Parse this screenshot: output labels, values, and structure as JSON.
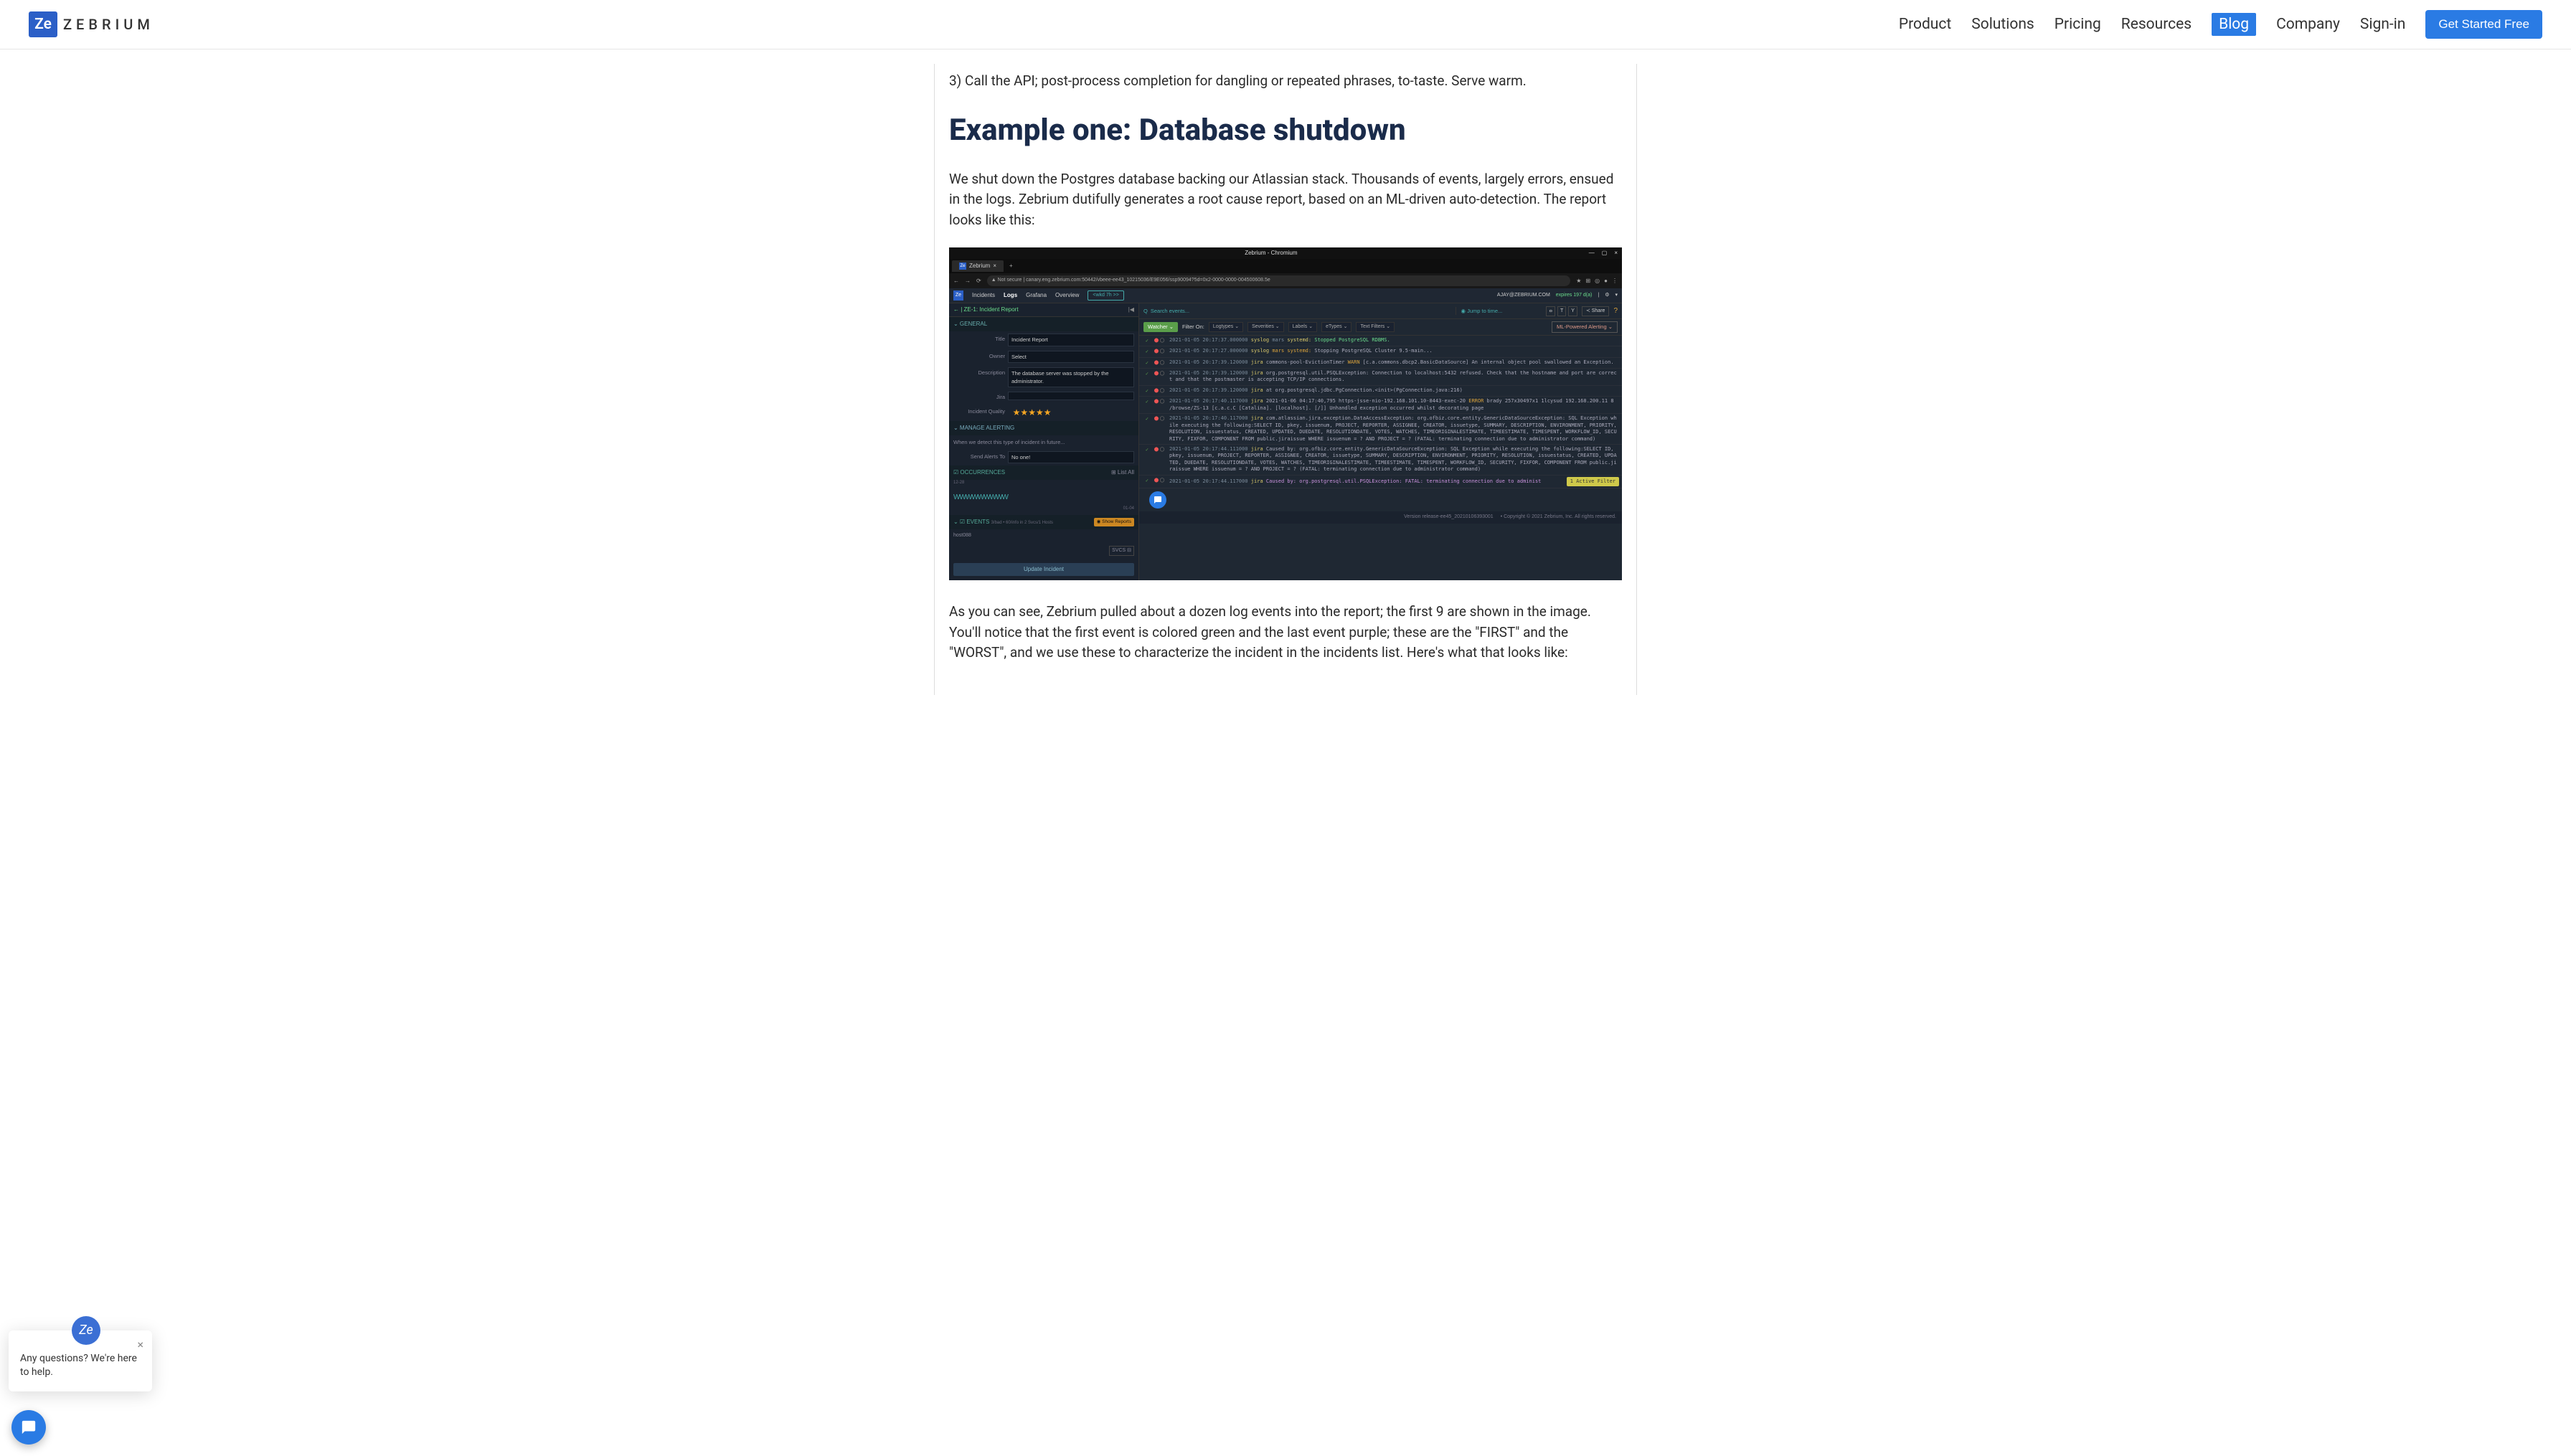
{
  "brand": {
    "badge": "Ze",
    "name": "ZEBRIUM"
  },
  "nav": {
    "product": "Product",
    "solutions": "Solutions",
    "pricing": "Pricing",
    "resources": "Resources",
    "blog": "Blog",
    "company": "Company",
    "signin": "Sign-in",
    "cta": "Get Started Free"
  },
  "article": {
    "step3": "3) Call the API; post-process completion for dangling or repeated phrases, to-taste. Serve warm.",
    "h2": "Example one: Database shutdown",
    "intro": "We shut down the Postgres database backing our Atlassian stack. Thousands of events, largely errors, ensued in the logs. Zebrium dutifully generates a root cause report, based on an ML-driven auto-detection. The report looks like this:",
    "after": "As you can see, Zebrium pulled about a dozen log events into the report; the first 9 are shown in the image. You'll notice that the first event is colored green and the last event purple; these are the \"FIRST\" and the \"WORST\", and we use these to characterize the incident in the incidents list. Here's what that looks like:"
  },
  "embed": {
    "chrome": {
      "title": "Zebrium - Chromium",
      "min": "—",
      "max": "▢",
      "close": "×"
    },
    "tab": {
      "favicon": "Ze",
      "label": "Zebrium",
      "close": "×"
    },
    "url": {
      "back": "←",
      "fwd": "→",
      "reload": "⟳",
      "lock": "▲ Not secure",
      "text": "canary.eng.zebrium.com:50442/vbeee-ee43_10215036/E9E056/ssp90094?5d=0x2-0000-0000-004500608.5e",
      "star": "★"
    },
    "app": {
      "logo": "Ze",
      "tab_incidents": "Incidents",
      "tab_logs": "Logs",
      "tab_grafana": "Grafana",
      "tab_overview": "Overview",
      "timerange": "<wkd 7h >>",
      "user": "AJAY@ZEBRIUM.COM",
      "expiry": "expires 197 d(a)"
    },
    "sidebar": {
      "header": "← | ZE-1: Incident Report",
      "collapse": "|◀",
      "general": "⌄ GENERAL",
      "title_label": "Title",
      "title_val": "Incident Report",
      "owner_label": "Owner",
      "owner_val": "Select",
      "desc_label": "Description",
      "desc_val": "The database server was stopped by the administrator.",
      "jira_label": "Jira",
      "quality_label": "Incident Quality",
      "stars": "★★★★★",
      "manage": "⌄ MANAGE ALERTING",
      "future": "When we detect this type of incident in future...",
      "sendto_label": "Send Alerts To",
      "sendto_val": "No one!",
      "occ": "☑ OCCURRENCES",
      "occ_right": "⊞ List All",
      "spark_start": "12-28",
      "spark_end": "01-04",
      "spark": "WWWWWWWWW",
      "events": "⌄ ☑ EVENTS",
      "events_sub": "3/bad • 60/info in 2 Svcs/1 Hosts",
      "show_reports": "◉ Show Reports",
      "host": "host088",
      "svcs_label": "SVCS ⊟",
      "update": "Update Incident"
    },
    "searchbar": {
      "icon": "Q",
      "placeholder": "Search events...",
      "jump": "◉ Jump to time...",
      "a": "ⴰ",
      "t": "T",
      "y": "Y",
      "share": "≺ Share",
      "help": "?"
    },
    "filters": {
      "watcher": "Watcher ⌄",
      "filteron": "Filter On:",
      "logtypes": "Logtypes ⌄",
      "severities": "Severities ⌄",
      "labels": "Labels ⌄",
      "etypes": "eTypes ⌄",
      "textfilters": "Text Filters ⌄",
      "ml": "ML-Powered Alerting ⌄"
    },
    "logs": [
      "2021-01-05 20:17:37.000000 syslog mars systemd: Stopped PostgreSQL RDBMS.",
      "2021-01-05 20:17:37.000000 syslog mars systemd: Stopping PostgreSQL Cluster 9.5-main...",
      "2021-01-05 20:17:39.120000 jira commons-pool-EvictionTimer WARN [c.a.commons.dbcp2.BasicDataSource] An internal object pool swallowed an Exception.",
      "2021-01-05 20:17:39.120000 jira org.postgresql.util.PSQLException: Connection to localhost:5432 refused. Check that the hostname and port are correct and that the postmaster is accepting TCP/IP connections.",
      "2021-01-05 20:17:39.120000 jira at org.postgresql.jdbc.PgConnection.<init>(PgConnection.java:216)",
      "2021-01-05 20:17:40.117000 jira 2021-01-06 04:17:40,795 https-jsse-nio-192.168.101.10-8443-exec-20 ERROR brady 257x30497x1 1lcysud 192.168.200.11 8 /browse/ZS-13 [c.a.c.C [Catalina]. [localhost]. [/]] Unhandled exception occurred whilst decorating page",
      "2021-01-05 20:17:40.117000 jira com.atlassian.jira.exception.DataAccessException: org.ofbiz.core.entity.GenericDataSourceException: SQL Exception while executing the following:SELECT ID, pkey, issuenum, PROJECT, REPORTER, ASSIGNEE, CREATOR, issuetype, SUMMARY, DESCRIPTION, ENVIRONMENT, PRIORITY, RESOLUTION, issuestatus, CREATED, UPDATED, DUEDATE, RESOLUTIONDATE, VOTES, WATCHES, TIMEORIGINALESTIMATE, TIMEESTIMATE, TIMESPENT, WORKFLOW_ID, SECURITY, FIXFOR, COMPONENT FROM public.jiraissue WHERE issuenum = ? AND PROJECT = ? (FATAL: terminating connection due to administrator command)",
      "2021-01-05 20:17:44.111000 jira Caused by: org.ofbiz.core.entity.GenericDataSourceException: SQL Exception while executing the following:SELECT ID, pkey, issuenum, PROJECT, REPORTER, ASSIGNEE, CREATOR, issuetype, SUMMARY, DESCRIPTION, ENVIRONMENT, PRIORITY, RESOLUTION, issuestatus, CREATED, UPDATED, DUEDATE, RESOLUTIONDATE, VOTES, WATCHES, TIMEORIGINALESTIMATE, TIMEESTIMATE, TIMESPENT, WORKFLOW_ID, SECURITY, FIXFOR, COMPONENT FROM public.jiraissue WHERE issuenum = ? AND PROJECT = ? (FATAL: terminating connection due to administrator command)",
      "2021-01-05 20:17:44.117000 jira Caused by: org.postgresql.util.PSQLException: FATAL: terminating connection due to administ"
    ],
    "active_filter": "1 Active Filter",
    "footer": {
      "version": "Version release-ee45_20210106393001",
      "copyright": "• Copyright © 2021 Zebrium, Inc. All rights reserved."
    }
  },
  "chat": {
    "ze": "Ze",
    "message": "Any questions? We're here to help.",
    "close": "×"
  }
}
